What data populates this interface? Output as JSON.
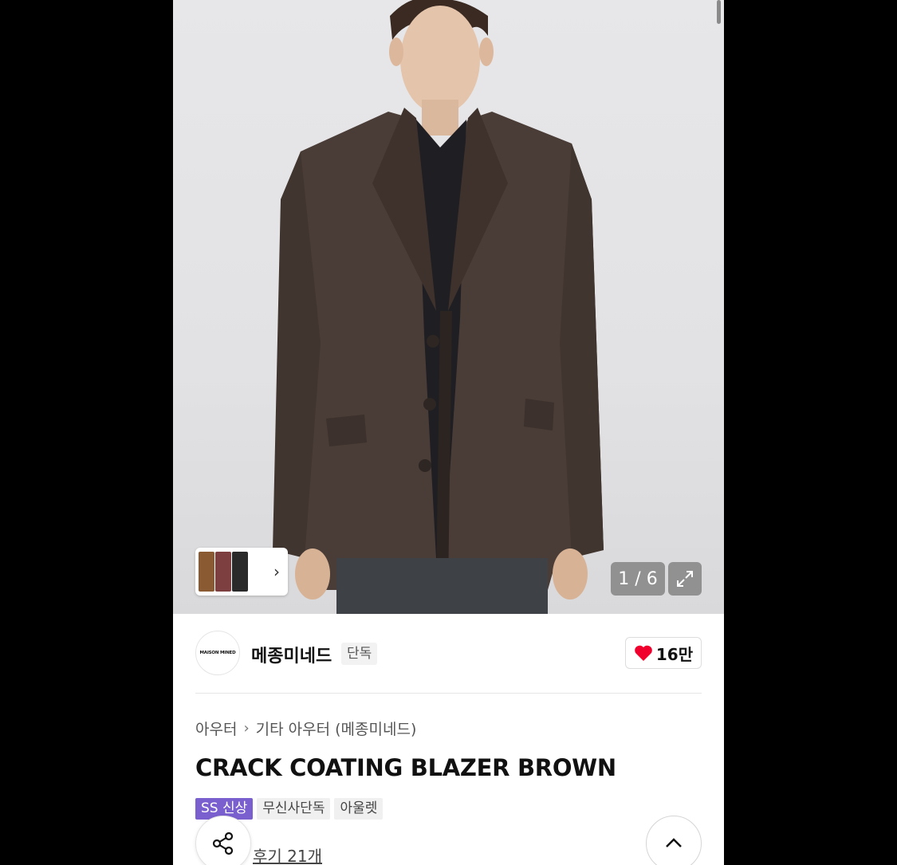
{
  "gallery": {
    "counter": "1 / 6",
    "thumbnail_colors": [
      "#8a5a32",
      "#7d3f3f",
      "#2a2a2a"
    ]
  },
  "brand": {
    "logo_text": "MAISON MINED",
    "name": "메종미네드",
    "tag": "단독"
  },
  "like": {
    "count": "16만",
    "color": "#f2002d"
  },
  "breadcrumb": {
    "category": "아우터",
    "subcategory": "기타 아우터 (메종미네드)"
  },
  "product": {
    "title": "CRACK COATING BLAZER BROWN",
    "badges": [
      "SS 신상",
      "무신사단독",
      "아울렛"
    ],
    "review_link": "후기 21개"
  },
  "colors": {
    "accent_purple": "#7a5fcf"
  }
}
